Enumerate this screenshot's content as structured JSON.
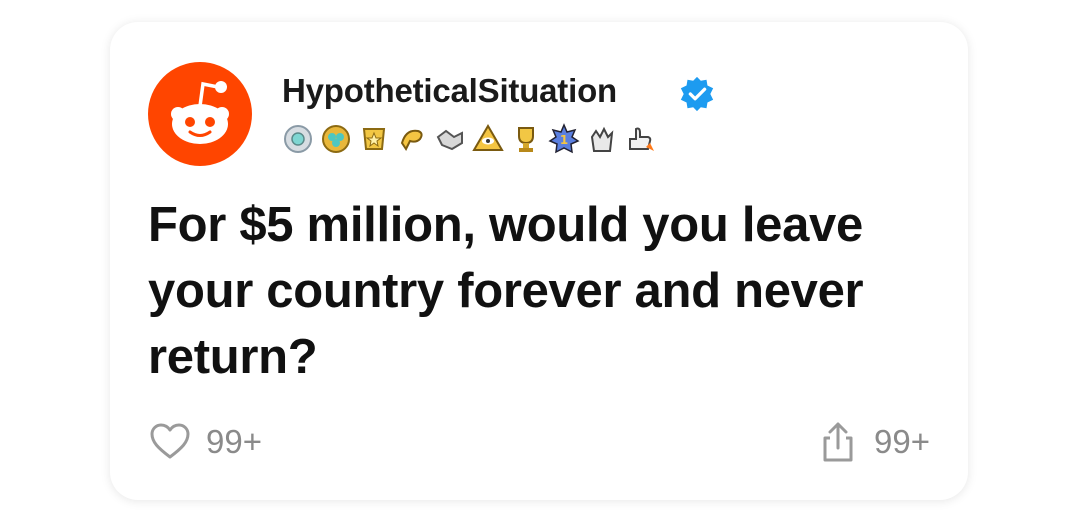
{
  "post": {
    "username": "HypotheticalSituation",
    "title": "For $5 million, would you leave your country forever and never return?",
    "likes": "99+",
    "shares": "99+"
  },
  "icons": {
    "avatar": "reddit-snoo-icon",
    "verified": "verified-check-icon",
    "like": "heart-icon",
    "share": "share-icon"
  },
  "awards": [
    "silver-award-icon",
    "helpful-award-icon",
    "gold-medal-award-icon",
    "pointing-award-icon",
    "handshake-award-icon",
    "eye-pyramid-award-icon",
    "trophy-award-icon",
    "number-one-award-icon",
    "clapping-award-icon",
    "rocket-thumbs-award-icon"
  ],
  "colors": {
    "brand": "#FF4500",
    "verified": "#1D9BF0",
    "muted": "#8A8A8A",
    "award_gold": "#F5C542"
  }
}
